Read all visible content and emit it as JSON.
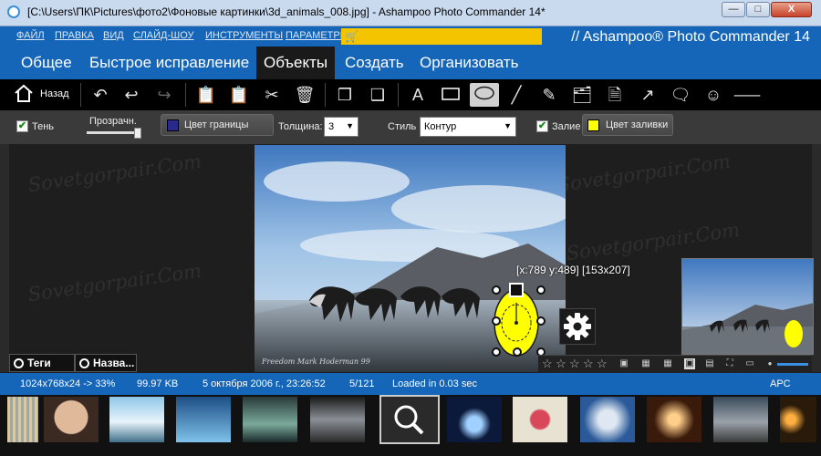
{
  "window": {
    "title": "[C:\\Users\\ПК\\Pictures\\фото2\\Фоновые картинки\\3d_animals_008.jpg] - Ashampoo Photo Commander 14*",
    "min_label": "—",
    "max_label": "□",
    "close_label": "X"
  },
  "menu": {
    "items": [
      "ФАЙЛ",
      "ПРАВКА",
      "ВИД",
      "СЛАЙД-ШОУ",
      "ИНСТРУМЕНТЫ",
      "ПАРАМЕТРЫ"
    ],
    "brand": "// Ashampoo® Photo Commander 14"
  },
  "tabs": [
    "Общее",
    "Быстрое исправление",
    "Объекты",
    "Создать",
    "Организовать"
  ],
  "toolbar": {
    "back_label": "Назад"
  },
  "options": {
    "shadow_label": "Тень",
    "shadow_checked": true,
    "opacity_label": "Прозрачн.",
    "opacity_value": 1.0,
    "border_color_label": "Цвет границы",
    "border_color": "#2a2a8c",
    "thickness_label": "Толщина:",
    "thickness_value": "3",
    "style_label": "Стиль",
    "style_value": "Контур",
    "fill_label": "Залие",
    "fill_checked": true,
    "fill_color_label": "Цвет заливки",
    "fill_color": "#ffff00"
  },
  "canvas": {
    "watermark": "Sovetgorpair.Com",
    "photo_signature": "Freedom Mark Hoderman 99",
    "coords_text": "[x:789 y:489] [153x207]"
  },
  "panel_tabs": {
    "tags": "Теги",
    "names": "Назва..."
  },
  "rating": {
    "stars_total": 5,
    "stars_filled": 0
  },
  "status": {
    "dimensions": "1024x768x24 -> 33%",
    "size": "99.97 KB",
    "date": "5 октября 2006 г., 23:26:52",
    "index": "5/121",
    "load": "Loaded in 0.03 sec",
    "apc": "APC"
  },
  "colors": {
    "accent": "#1565b8",
    "fill": "#ffff00"
  }
}
